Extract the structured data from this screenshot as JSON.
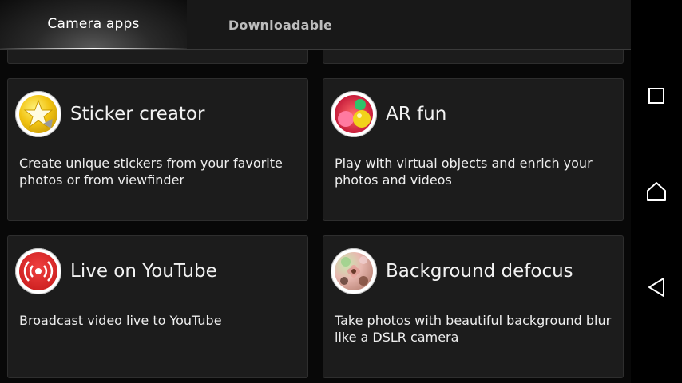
{
  "tabs": [
    {
      "label": "Camera apps",
      "active": true
    },
    {
      "label": "Downloadable",
      "active": false
    }
  ],
  "cards": [
    {
      "title": "Sticker creator",
      "description": "Create unique stickers from your favorite photos or from viewfinder",
      "icon": "sticker-creator-icon"
    },
    {
      "title": "AR fun",
      "description": "Play with virtual objects and enrich your photos and videos",
      "icon": "ar-fun-icon"
    },
    {
      "title": "Live on YouTube",
      "description": "Broadcast video live to YouTube",
      "icon": "live-broadcast-icon"
    },
    {
      "title": "Background defocus",
      "description": "Take photos with beautiful background blur like a DSLR camera",
      "icon": "background-defocus-icon"
    }
  ],
  "navbar": {
    "buttons": [
      "recents",
      "home",
      "back"
    ]
  },
  "colors": {
    "card_bg": "#1c1c1c",
    "tabbar_bg": "#181818",
    "text": "#f2f2f2",
    "live_red": "#d32020",
    "sticker_yellow": "#f0c010"
  }
}
